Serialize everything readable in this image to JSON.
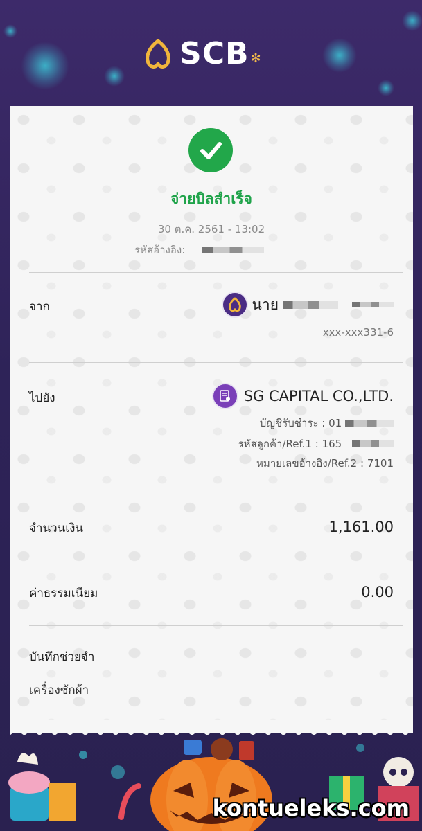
{
  "header": {
    "brand": "SCB"
  },
  "status": {
    "title": "จ่ายบิลสำเร็จ",
    "datetime": "30 ต.ค. 2561 - 13:02",
    "ref_label": "รหัสอ้างอิง:"
  },
  "from": {
    "label": "จาก",
    "name": "นาย",
    "account": "xxx-xxx331-6"
  },
  "to": {
    "label": "ไปยัง",
    "name": "SG CAPITAL CO.,LTD.",
    "account_line": "บัญชีรับชำระ : 01",
    "ref1_line": "รหัสลูกค้า/Ref.1 : 165",
    "ref2_line": "หมายเลขอ้างอิง/Ref.2 : 7101"
  },
  "amount": {
    "label": "จำนวนเงิน",
    "value": "1,161.00"
  },
  "fee": {
    "label": "ค่าธรรมเนียม",
    "value": "0.00"
  },
  "memo": {
    "label": "บันทึกช่วยจำ",
    "value": "เครื่องซักผ้า"
  },
  "watermark": "kontueleks.com",
  "colors": {
    "brand_purple": "#4b2d84",
    "success_green": "#22a74a",
    "background": "#2e2358"
  }
}
